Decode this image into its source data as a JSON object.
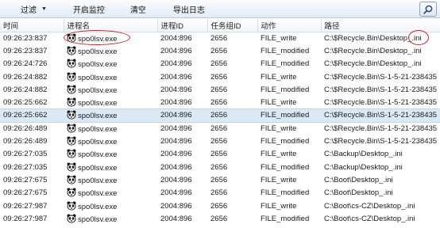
{
  "toolbar": {
    "filter_label": "过滤",
    "start_label": "开启监控",
    "clear_label": "清空",
    "export_label": "导出日志",
    "search_icon": "search-icon"
  },
  "table": {
    "headers": [
      "时间",
      "进程名",
      "进程ID",
      "任务组ID",
      "动作",
      "路径"
    ],
    "rows": [
      {
        "time": "09:26:23:837",
        "process": "spo0lsv.exe",
        "pid": "2004:896",
        "gid": "2656",
        "action": "FILE_write",
        "path": "C:\\$Recycle.Bin\\Desktop_.ini"
      },
      {
        "time": "09:26:23:837",
        "process": "spo0lsv.exe",
        "pid": "2004:896",
        "gid": "2656",
        "action": "FILE_modified",
        "path": "C:\\$Recycle.Bin\\Desktop_.ini"
      },
      {
        "time": "09:26:24:726",
        "process": "spo0lsv.exe",
        "pid": "2004:896",
        "gid": "2656",
        "action": "FILE_modified",
        "path": "C:\\$Recycle.Bin\\Desktop_.ini"
      },
      {
        "time": "09:26:24:882",
        "process": "spo0lsv.exe",
        "pid": "2004:896",
        "gid": "2656",
        "action": "FILE_write",
        "path": "C:\\$Recycle.Bin\\S-1-5-21-238435"
      },
      {
        "time": "09:26:24:882",
        "process": "spo0lsv.exe",
        "pid": "2004:896",
        "gid": "2656",
        "action": "FILE_modified",
        "path": "C:\\$Recycle.Bin\\S-1-5-21-238435"
      },
      {
        "time": "09:26:25:662",
        "process": "spo0lsv.exe",
        "pid": "2004:896",
        "gid": "2656",
        "action": "FILE_write",
        "path": "C:\\$Recycle.Bin\\S-1-5-21-238435"
      },
      {
        "time": "09:26:25:662",
        "process": "spo0lsv.exe",
        "pid": "2004:896",
        "gid": "2656",
        "action": "FILE_modified",
        "path": "C:\\$Recycle.Bin\\S-1-5-21-238435"
      },
      {
        "time": "09:26:26:489",
        "process": "spo0lsv.exe",
        "pid": "2004:896",
        "gid": "2656",
        "action": "FILE_write",
        "path": "C:\\$Recycle.Bin\\S-1-5-21-238435"
      },
      {
        "time": "09:26:26:489",
        "process": "spo0lsv.exe",
        "pid": "2004:896",
        "gid": "2656",
        "action": "FILE_modified",
        "path": "C:\\$Recycle.Bin\\S-1-5-21-238435"
      },
      {
        "time": "09:26:27:035",
        "process": "spo0lsv.exe",
        "pid": "2004:896",
        "gid": "2656",
        "action": "FILE_write",
        "path": "C:\\Backup\\Desktop_.ini"
      },
      {
        "time": "09:26:27:035",
        "process": "spo0lsv.exe",
        "pid": "2004:896",
        "gid": "2656",
        "action": "FILE_modified",
        "path": "C:\\Backup\\Desktop_.ini"
      },
      {
        "time": "09:26:27:675",
        "process": "spo0lsv.exe",
        "pid": "2004:896",
        "gid": "2656",
        "action": "FILE_write",
        "path": "C:\\Boot\\Desktop_.ini"
      },
      {
        "time": "09:26:27:675",
        "process": "spo0lsv.exe",
        "pid": "2004:896",
        "gid": "2656",
        "action": "FILE_modified",
        "path": "C:\\Boot\\Desktop_.ini"
      },
      {
        "time": "09:26:27:987",
        "process": "spo0lsv.exe",
        "pid": "2004:896",
        "gid": "2656",
        "action": "FILE_write",
        "path": "C:\\Boot\\cs-CZ\\Desktop_.ini"
      },
      {
        "time": "09:26:27:987",
        "process": "spo0lsv.exe",
        "pid": "2004:896",
        "gid": "2656",
        "action": "FILE_modified",
        "path": "C:\\Boot\\cs-CZ\\Desktop_.ini"
      }
    ],
    "selected_row": 6,
    "process_icon": "panda-icon"
  },
  "colors": {
    "highlight_ring": "#c8242b",
    "selected_row": "#dbe8f6"
  }
}
